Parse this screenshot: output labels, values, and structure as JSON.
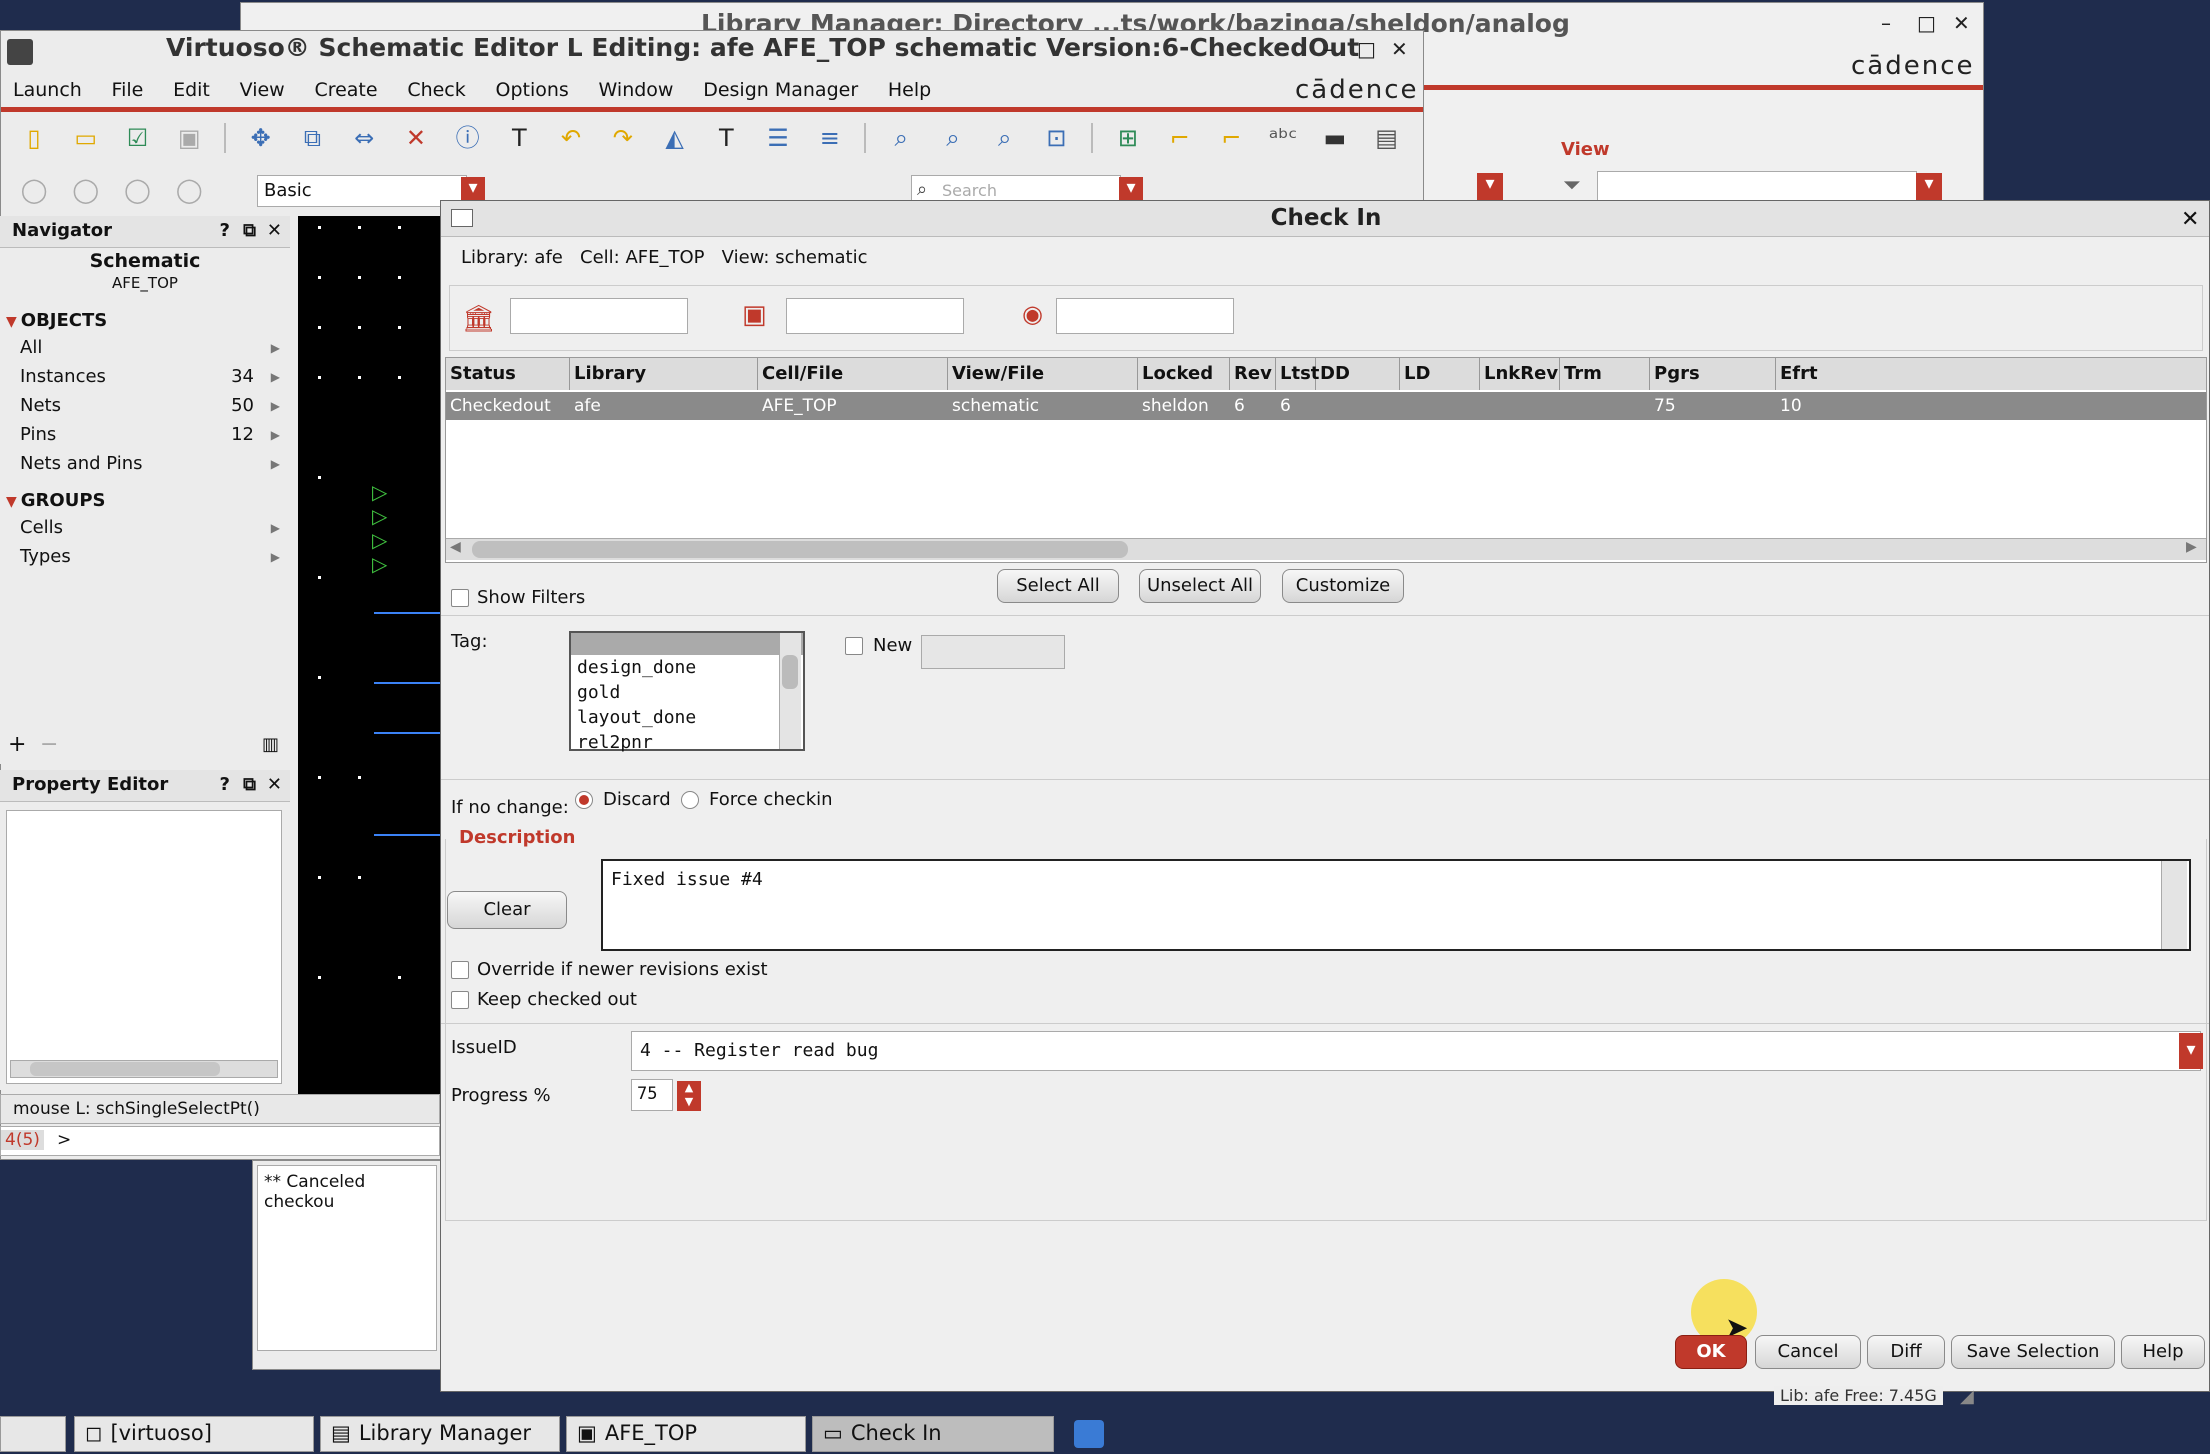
{
  "lib_manager": {
    "title": "Library Manager: Directory ...ts/work/bazinga/sheldon/analog",
    "brand": "cādence",
    "view_label": "View"
  },
  "schematic": {
    "title": "Virtuoso® Schematic Editor L Editing: afe AFE_TOP schematic Version:6-CheckedOut",
    "brand": "cādence",
    "menu": [
      "Launch",
      "File",
      "Edit",
      "View",
      "Create",
      "Check",
      "Options",
      "Window",
      "Design Manager",
      "Help"
    ],
    "toolbar2_select": "Basic",
    "search_placeholder": "Search"
  },
  "navigator": {
    "title": "Navigator",
    "heading": "Schematic",
    "subheading": "AFE_TOP",
    "objects_label": "OBJECTS",
    "objects": [
      {
        "label": "All",
        "count": ""
      },
      {
        "label": "Instances",
        "count": "34"
      },
      {
        "label": "Nets",
        "count": "50"
      },
      {
        "label": "Pins",
        "count": "12"
      },
      {
        "label": "Nets and Pins",
        "count": ""
      }
    ],
    "groups_label": "GROUPS",
    "groups": [
      {
        "label": "Cells"
      },
      {
        "label": "Types"
      }
    ]
  },
  "property_editor": {
    "title": "Property Editor"
  },
  "status": {
    "mouse": "mouse L: schSingleSelectPt()",
    "counter": "4(5)",
    "prompt": ">",
    "log": "** Canceled checkou"
  },
  "dialog": {
    "title": "Check In",
    "info": "Library: afe   Cell: AFE_TOP   View: schematic",
    "columns": [
      "Status",
      "Library",
      "Cell/File",
      "View/File",
      "Locked",
      "Rev",
      "Ltst",
      "DD",
      "LD",
      "LnkRev",
      "Trm",
      "Pgrs",
      "Efrt"
    ],
    "rows": [
      [
        "Checkedout",
        "afe",
        "AFE_TOP",
        "schematic",
        "sheldon",
        "6",
        "6",
        "",
        "",
        "",
        "",
        "75",
        "10"
      ]
    ],
    "buttons": {
      "select_all": "Select All",
      "unselect_all": "Unselect All",
      "customize": "Customize"
    },
    "show_filters": "Show Filters",
    "tag_label": "Tag:",
    "tags": [
      "design_done",
      "gold",
      "layout_done",
      "rel2pnr"
    ],
    "new_label": "New",
    "if_no_change_label": "If no change:",
    "discard_label": "Discard",
    "force_label": "Force checkin",
    "description_label": "Description",
    "clear_label": "Clear",
    "description_value": "Fixed issue #4",
    "override_label": "Override if newer revisions exist",
    "keep_label": "Keep checked out",
    "issue_label": "IssueID",
    "issue_value": "4 -- Register read bug",
    "progress_label": "Progress %",
    "progress_value": "75",
    "footer": {
      "ok": "OK",
      "cancel": "Cancel",
      "diff": "Diff",
      "save_selection": "Save Selection",
      "help": "Help"
    },
    "statusbar": "Lib: afe  Free: 7.45G"
  },
  "taskbar": [
    {
      "label": "[virtuoso]"
    },
    {
      "label": "Library Manager"
    },
    {
      "label": "AFE_TOP"
    },
    {
      "label": "Check In"
    }
  ],
  "colors": {
    "accent": "#c0392b",
    "ok": "#c0392b",
    "selected_row": "#8a8a8a",
    "desktop": "#1f2c4d"
  }
}
